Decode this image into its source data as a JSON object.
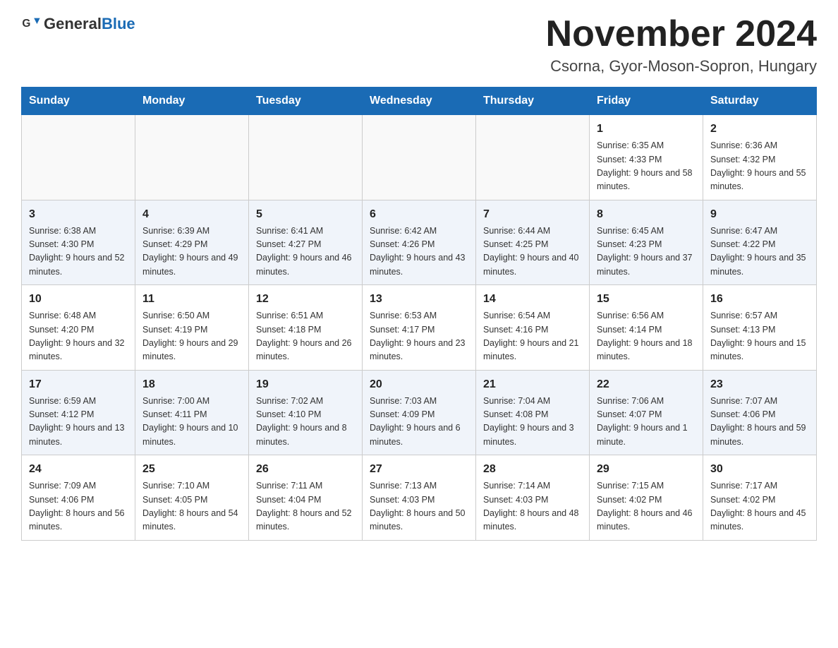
{
  "header": {
    "logo_general": "General",
    "logo_blue": "Blue",
    "month_title": "November 2024",
    "subtitle": "Csorna, Gyor-Moson-Sopron, Hungary"
  },
  "days_of_week": [
    "Sunday",
    "Monday",
    "Tuesday",
    "Wednesday",
    "Thursday",
    "Friday",
    "Saturday"
  ],
  "weeks": [
    [
      {
        "day": "",
        "info": ""
      },
      {
        "day": "",
        "info": ""
      },
      {
        "day": "",
        "info": ""
      },
      {
        "day": "",
        "info": ""
      },
      {
        "day": "",
        "info": ""
      },
      {
        "day": "1",
        "info": "Sunrise: 6:35 AM\nSunset: 4:33 PM\nDaylight: 9 hours and 58 minutes."
      },
      {
        "day": "2",
        "info": "Sunrise: 6:36 AM\nSunset: 4:32 PM\nDaylight: 9 hours and 55 minutes."
      }
    ],
    [
      {
        "day": "3",
        "info": "Sunrise: 6:38 AM\nSunset: 4:30 PM\nDaylight: 9 hours and 52 minutes."
      },
      {
        "day": "4",
        "info": "Sunrise: 6:39 AM\nSunset: 4:29 PM\nDaylight: 9 hours and 49 minutes."
      },
      {
        "day": "5",
        "info": "Sunrise: 6:41 AM\nSunset: 4:27 PM\nDaylight: 9 hours and 46 minutes."
      },
      {
        "day": "6",
        "info": "Sunrise: 6:42 AM\nSunset: 4:26 PM\nDaylight: 9 hours and 43 minutes."
      },
      {
        "day": "7",
        "info": "Sunrise: 6:44 AM\nSunset: 4:25 PM\nDaylight: 9 hours and 40 minutes."
      },
      {
        "day": "8",
        "info": "Sunrise: 6:45 AM\nSunset: 4:23 PM\nDaylight: 9 hours and 37 minutes."
      },
      {
        "day": "9",
        "info": "Sunrise: 6:47 AM\nSunset: 4:22 PM\nDaylight: 9 hours and 35 minutes."
      }
    ],
    [
      {
        "day": "10",
        "info": "Sunrise: 6:48 AM\nSunset: 4:20 PM\nDaylight: 9 hours and 32 minutes."
      },
      {
        "day": "11",
        "info": "Sunrise: 6:50 AM\nSunset: 4:19 PM\nDaylight: 9 hours and 29 minutes."
      },
      {
        "day": "12",
        "info": "Sunrise: 6:51 AM\nSunset: 4:18 PM\nDaylight: 9 hours and 26 minutes."
      },
      {
        "day": "13",
        "info": "Sunrise: 6:53 AM\nSunset: 4:17 PM\nDaylight: 9 hours and 23 minutes."
      },
      {
        "day": "14",
        "info": "Sunrise: 6:54 AM\nSunset: 4:16 PM\nDaylight: 9 hours and 21 minutes."
      },
      {
        "day": "15",
        "info": "Sunrise: 6:56 AM\nSunset: 4:14 PM\nDaylight: 9 hours and 18 minutes."
      },
      {
        "day": "16",
        "info": "Sunrise: 6:57 AM\nSunset: 4:13 PM\nDaylight: 9 hours and 15 minutes."
      }
    ],
    [
      {
        "day": "17",
        "info": "Sunrise: 6:59 AM\nSunset: 4:12 PM\nDaylight: 9 hours and 13 minutes."
      },
      {
        "day": "18",
        "info": "Sunrise: 7:00 AM\nSunset: 4:11 PM\nDaylight: 9 hours and 10 minutes."
      },
      {
        "day": "19",
        "info": "Sunrise: 7:02 AM\nSunset: 4:10 PM\nDaylight: 9 hours and 8 minutes."
      },
      {
        "day": "20",
        "info": "Sunrise: 7:03 AM\nSunset: 4:09 PM\nDaylight: 9 hours and 6 minutes."
      },
      {
        "day": "21",
        "info": "Sunrise: 7:04 AM\nSunset: 4:08 PM\nDaylight: 9 hours and 3 minutes."
      },
      {
        "day": "22",
        "info": "Sunrise: 7:06 AM\nSunset: 4:07 PM\nDaylight: 9 hours and 1 minute."
      },
      {
        "day": "23",
        "info": "Sunrise: 7:07 AM\nSunset: 4:06 PM\nDaylight: 8 hours and 59 minutes."
      }
    ],
    [
      {
        "day": "24",
        "info": "Sunrise: 7:09 AM\nSunset: 4:06 PM\nDaylight: 8 hours and 56 minutes."
      },
      {
        "day": "25",
        "info": "Sunrise: 7:10 AM\nSunset: 4:05 PM\nDaylight: 8 hours and 54 minutes."
      },
      {
        "day": "26",
        "info": "Sunrise: 7:11 AM\nSunset: 4:04 PM\nDaylight: 8 hours and 52 minutes."
      },
      {
        "day": "27",
        "info": "Sunrise: 7:13 AM\nSunset: 4:03 PM\nDaylight: 8 hours and 50 minutes."
      },
      {
        "day": "28",
        "info": "Sunrise: 7:14 AM\nSunset: 4:03 PM\nDaylight: 8 hours and 48 minutes."
      },
      {
        "day": "29",
        "info": "Sunrise: 7:15 AM\nSunset: 4:02 PM\nDaylight: 8 hours and 46 minutes."
      },
      {
        "day": "30",
        "info": "Sunrise: 7:17 AM\nSunset: 4:02 PM\nDaylight: 8 hours and 45 minutes."
      }
    ]
  ]
}
